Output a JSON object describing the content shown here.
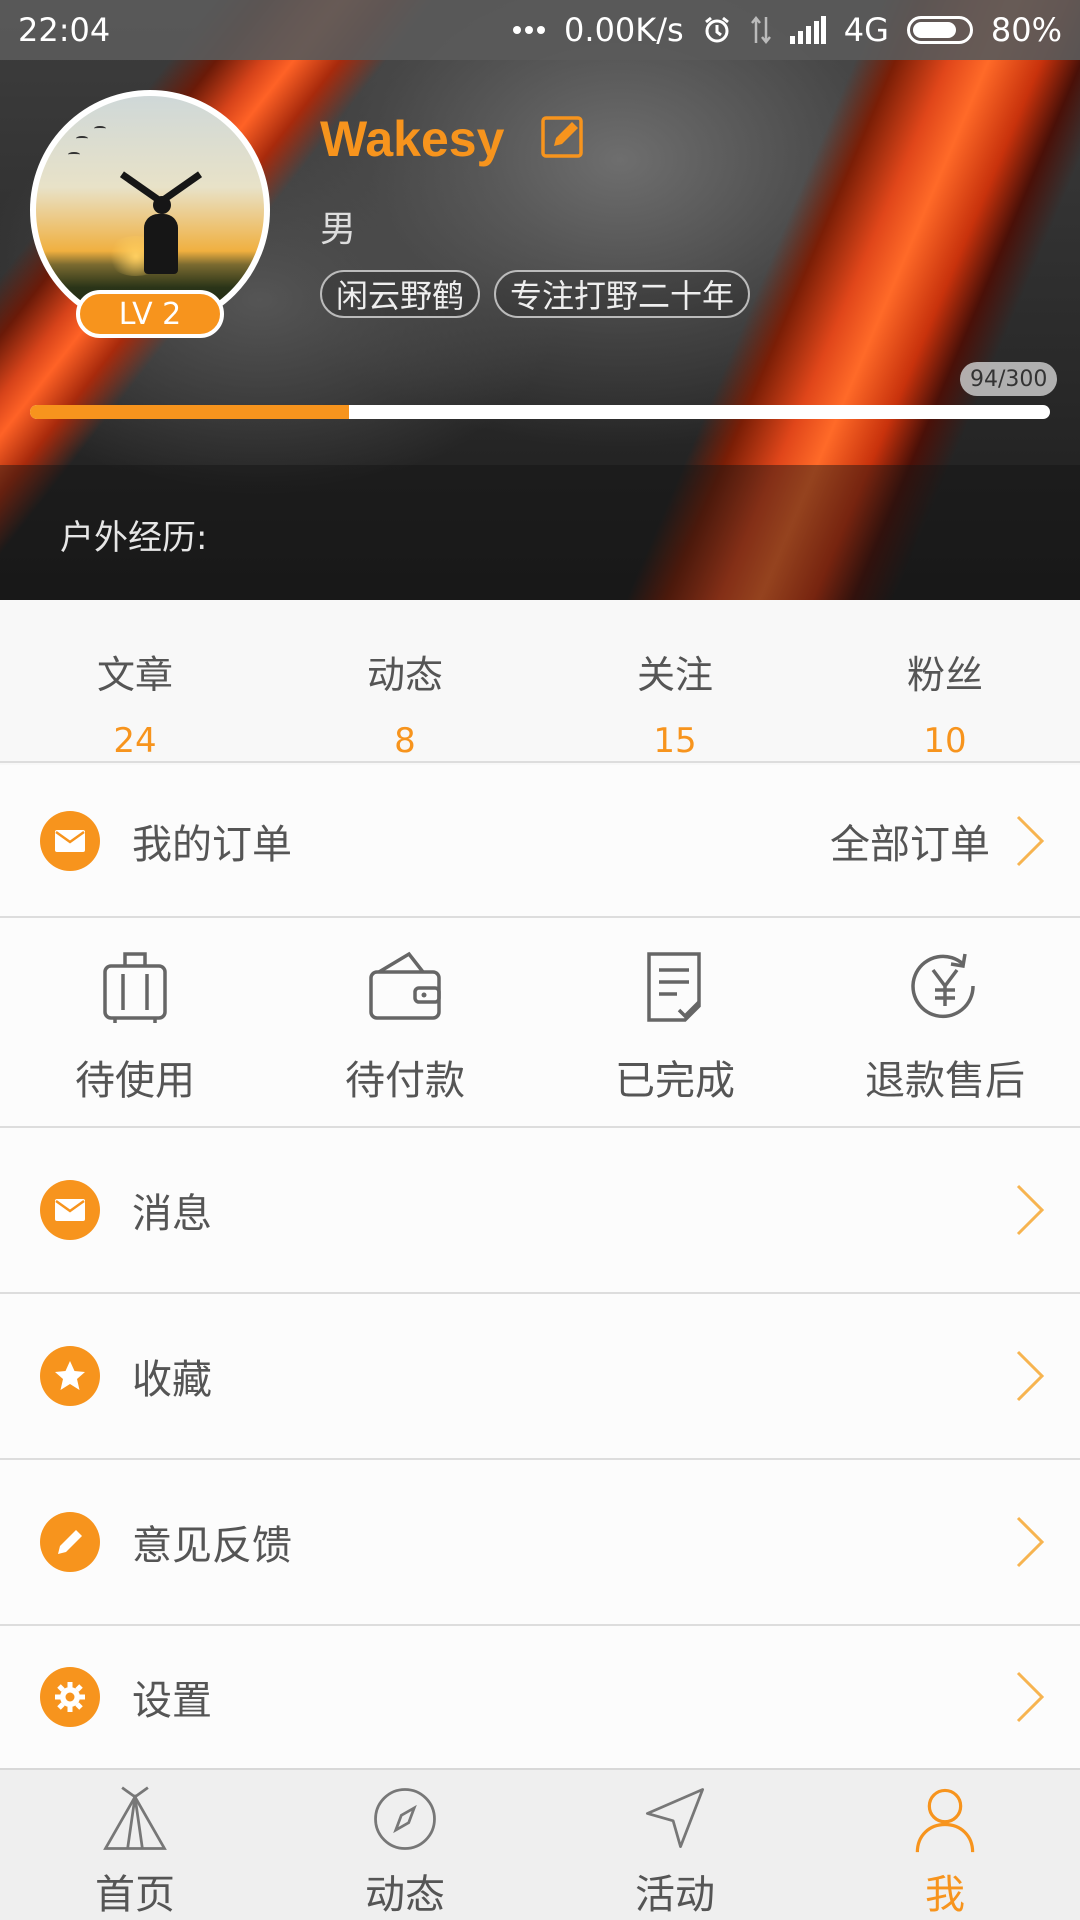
{
  "status_bar": {
    "time": "22:04",
    "network_speed": "0.00K/s",
    "network_type": "4G",
    "battery": "80%",
    "battery_level": 0.8
  },
  "profile": {
    "username": "Wakesy",
    "gender": "男",
    "level": "LV 2",
    "tags": [
      "闲云野鹤",
      "专注打野二十年"
    ],
    "xp_text": "94/300",
    "xp_progress": 0.313,
    "outdoor_label": "户外经历:"
  },
  "stats": [
    {
      "label": "文章",
      "value": "24"
    },
    {
      "label": "动态",
      "value": "8"
    },
    {
      "label": "关注",
      "value": "15"
    },
    {
      "label": "粉丝",
      "value": "10"
    }
  ],
  "orders": {
    "title": "我的订单",
    "all_label": "全部订单",
    "items": [
      {
        "label": "待使用",
        "icon": "luggage-icon"
      },
      {
        "label": "待付款",
        "icon": "wallet-icon"
      },
      {
        "label": "已完成",
        "icon": "document-check-icon"
      },
      {
        "label": "退款售后",
        "icon": "yen-refund-icon"
      }
    ]
  },
  "menu": [
    {
      "label": "消息",
      "icon": "mail-icon"
    },
    {
      "label": "收藏",
      "icon": "star-icon"
    },
    {
      "label": "意见反馈",
      "icon": "pencil-icon"
    },
    {
      "label": "设置",
      "icon": "gear-icon"
    }
  ],
  "tabs": [
    {
      "label": "首页",
      "icon": "tent-icon",
      "active": false
    },
    {
      "label": "动态",
      "icon": "compass-icon",
      "active": false
    },
    {
      "label": "活动",
      "icon": "navigation-icon",
      "active": false
    },
    {
      "label": "我",
      "icon": "user-icon",
      "active": true
    }
  ],
  "colors": {
    "accent": "#f7941d",
    "text": "#555555",
    "divider": "#dddddd"
  }
}
